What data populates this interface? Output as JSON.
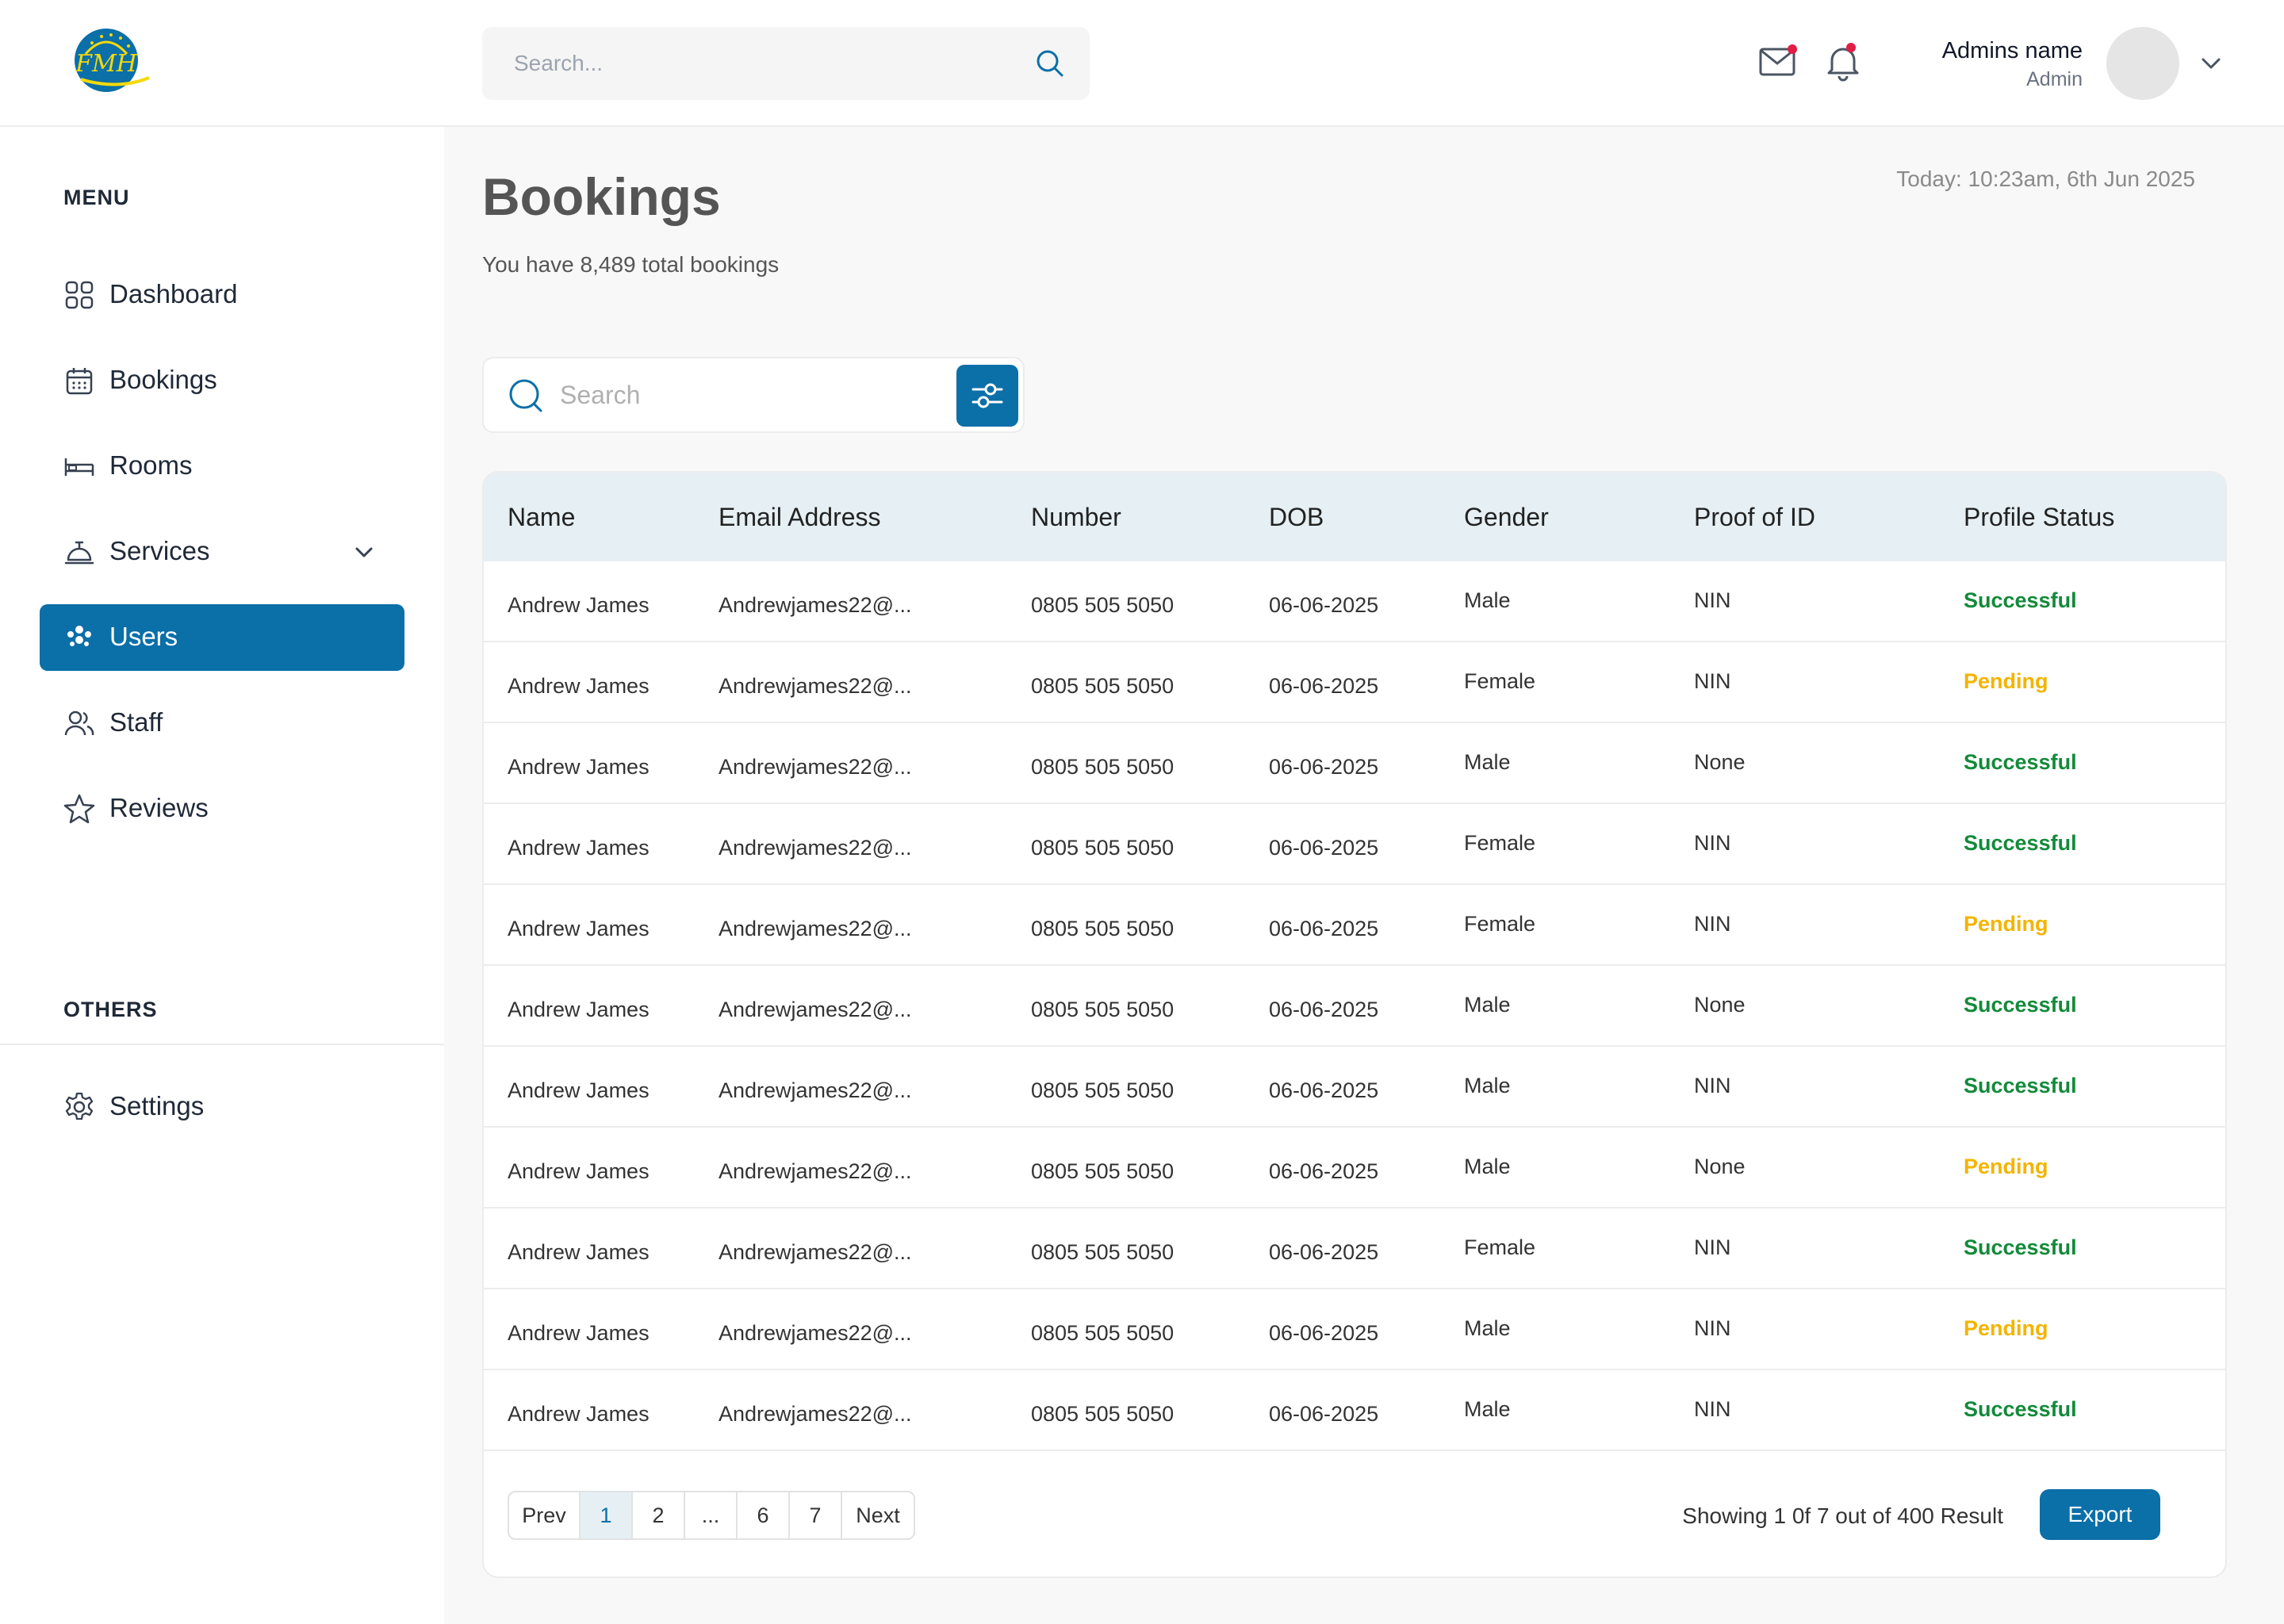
{
  "topbar": {
    "logo_text": "FMH",
    "search_placeholder": "Search...",
    "admin_name": "Admins name",
    "admin_role": "Admin"
  },
  "sidebar": {
    "menu_heading": "MENU",
    "others_heading": "OTHERS",
    "items": [
      {
        "label": "Dashboard",
        "icon": "grid-icon",
        "active": false
      },
      {
        "label": "Bookings",
        "icon": "calendar-icon",
        "active": false
      },
      {
        "label": "Rooms",
        "icon": "bed-icon",
        "active": false
      },
      {
        "label": "Services",
        "icon": "service-bell-icon",
        "active": false,
        "has_dropdown": true
      },
      {
        "label": "Users",
        "icon": "users-icon",
        "active": true
      },
      {
        "label": "Staff",
        "icon": "staff-icon",
        "active": false
      },
      {
        "label": "Reviews",
        "icon": "star-icon",
        "active": false
      }
    ],
    "others": [
      {
        "label": "Settings",
        "icon": "gear-icon"
      }
    ]
  },
  "main": {
    "title": "Bookings",
    "subtitle": "You have 8,489 total bookings",
    "today": "Today: 10:23am, 6th Jun 2025",
    "search_placeholder": "Search"
  },
  "table": {
    "columns": [
      "Name",
      "Email Address",
      "Number",
      "DOB",
      "Gender",
      "Proof of ID",
      "Profile Status"
    ],
    "rows": [
      {
        "name": "Andrew James",
        "email": "Andrewjames22@...",
        "number": "0805 505 5050",
        "dob": "06-06-2025",
        "gender": "Male",
        "proof": "NIN",
        "status": "Successful"
      },
      {
        "name": "Andrew James",
        "email": "Andrewjames22@...",
        "number": "0805 505 5050",
        "dob": "06-06-2025",
        "gender": "Female",
        "proof": "NIN",
        "status": "Pending"
      },
      {
        "name": "Andrew James",
        "email": "Andrewjames22@...",
        "number": "0805 505 5050",
        "dob": "06-06-2025",
        "gender": "Male",
        "proof": "None",
        "status": "Successful"
      },
      {
        "name": "Andrew James",
        "email": "Andrewjames22@...",
        "number": "0805 505 5050",
        "dob": "06-06-2025",
        "gender": "Female",
        "proof": "NIN",
        "status": "Successful"
      },
      {
        "name": "Andrew James",
        "email": "Andrewjames22@...",
        "number": "0805 505 5050",
        "dob": "06-06-2025",
        "gender": "Female",
        "proof": "NIN",
        "status": "Pending"
      },
      {
        "name": "Andrew James",
        "email": "Andrewjames22@...",
        "number": "0805 505 5050",
        "dob": "06-06-2025",
        "gender": "Male",
        "proof": "None",
        "status": "Successful"
      },
      {
        "name": "Andrew James",
        "email": "Andrewjames22@...",
        "number": "0805 505 5050",
        "dob": "06-06-2025",
        "gender": "Male",
        "proof": "NIN",
        "status": "Successful"
      },
      {
        "name": "Andrew James",
        "email": "Andrewjames22@...",
        "number": "0805 505 5050",
        "dob": "06-06-2025",
        "gender": "Male",
        "proof": "None",
        "status": "Pending"
      },
      {
        "name": "Andrew James",
        "email": "Andrewjames22@...",
        "number": "0805 505 5050",
        "dob": "06-06-2025",
        "gender": "Female",
        "proof": "NIN",
        "status": "Successful"
      },
      {
        "name": "Andrew James",
        "email": "Andrewjames22@...",
        "number": "0805 505 5050",
        "dob": "06-06-2025",
        "gender": "Male",
        "proof": "NIN",
        "status": "Pending"
      },
      {
        "name": "Andrew James",
        "email": "Andrewjames22@...",
        "number": "0805 505 5050",
        "dob": "06-06-2025",
        "gender": "Male",
        "proof": "NIN",
        "status": "Successful"
      }
    ]
  },
  "pagination": {
    "prev": "Prev",
    "pages": [
      "1",
      "2",
      "...",
      "6",
      "7"
    ],
    "active_page": "1",
    "next": "Next",
    "showing": "Showing 1 0f 7 out of 400 Result",
    "export_label": "Export"
  },
  "colors": {
    "accent": "#0b6fa8",
    "success": "#138a3a",
    "pending": "#f4b400",
    "notification_dot": "#e11d48"
  }
}
